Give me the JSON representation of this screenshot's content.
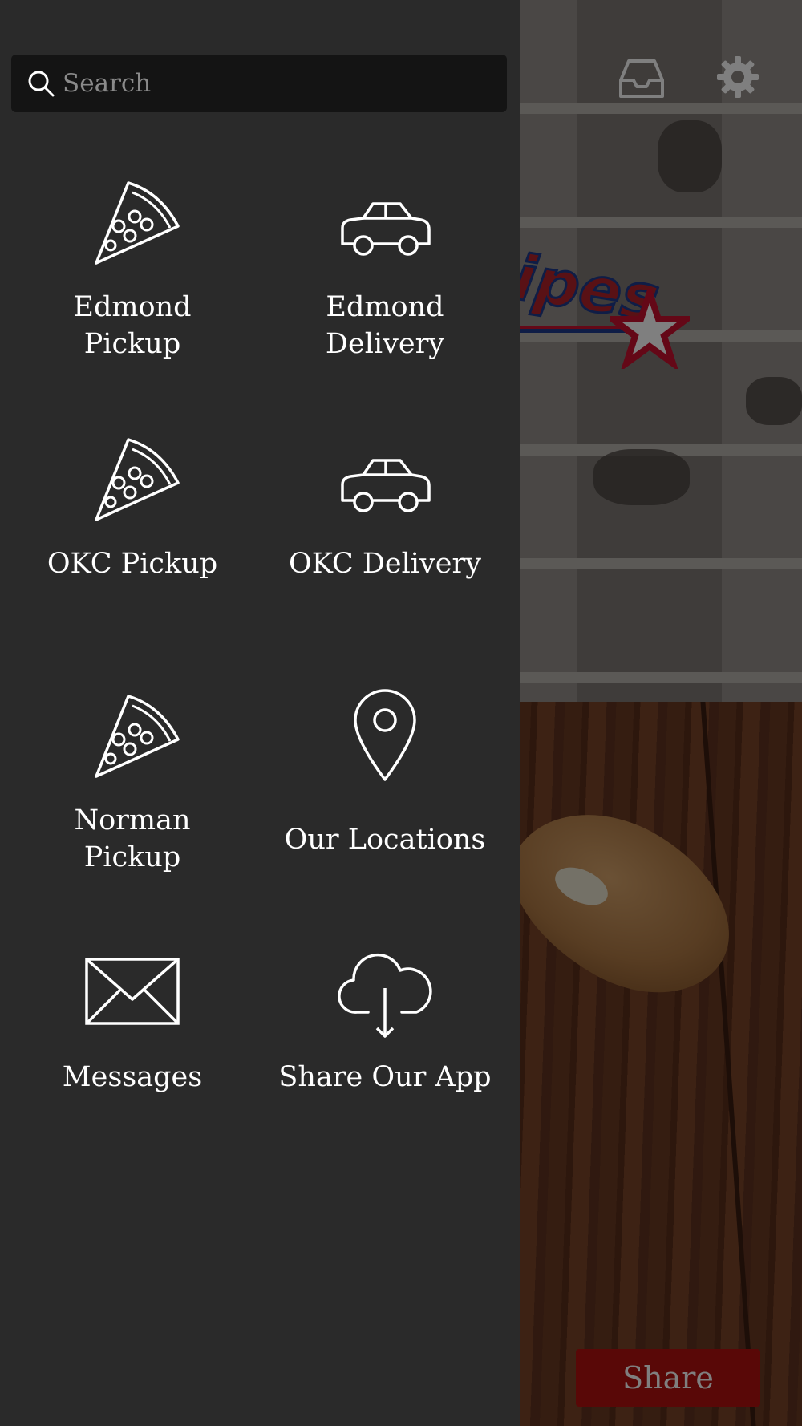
{
  "background": {
    "logo_fragment": "ipes",
    "share_label": "Share",
    "icons": [
      "inbox-icon",
      "gear-icon"
    ]
  },
  "drawer": {
    "search": {
      "placeholder": "Search",
      "value": ""
    },
    "items": [
      {
        "label": "Edmond\nPickup",
        "icon": "pizza-slice-icon"
      },
      {
        "label": "Edmond\nDelivery",
        "icon": "car-icon"
      },
      {
        "label": "OKC Pickup",
        "icon": "pizza-slice-icon"
      },
      {
        "label": "OKC Delivery",
        "icon": "car-icon"
      },
      {
        "label": "Norman\nPickup",
        "icon": "pizza-slice-icon"
      },
      {
        "label": "Our Locations",
        "icon": "map-pin-icon"
      },
      {
        "label": "Messages",
        "icon": "envelope-icon"
      },
      {
        "label": "Share Our App",
        "icon": "cloud-download-icon"
      }
    ]
  },
  "colors": {
    "drawer_bg": "#2a2a2a",
    "search_bg": "#141414",
    "share_button": "#b3100e",
    "icon_stroke": "#ffffff"
  }
}
